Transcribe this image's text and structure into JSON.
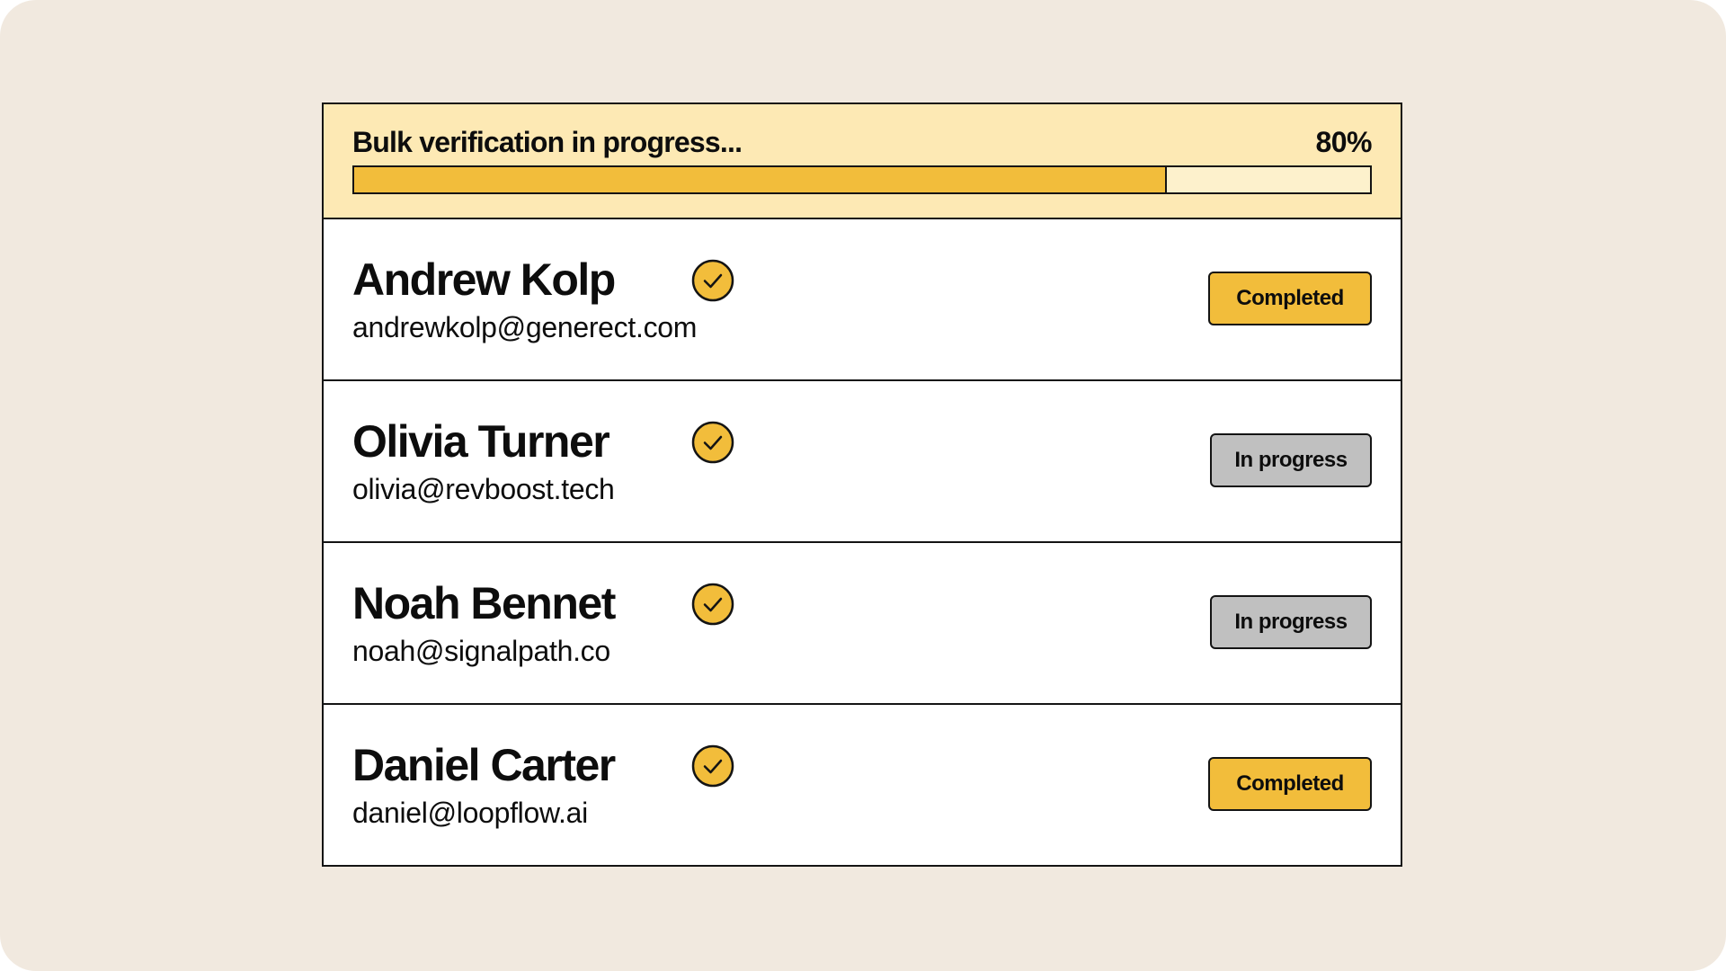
{
  "verification": {
    "title": "Bulk verification in progress...",
    "percent_label": "80%",
    "progress": 0.8,
    "accent_color": "#f2bd3b",
    "panel_color": "#fde9b4"
  },
  "contacts": [
    {
      "name": "Andrew Kolp",
      "email": "andrewkolp@generect.com",
      "status": "Completed",
      "verified_icon": "check-circle-icon"
    },
    {
      "name": "Olivia Turner",
      "email": "olivia@revboost.tech",
      "status": "In progress",
      "verified_icon": "check-circle-icon"
    },
    {
      "name": "Noah Bennet",
      "email": "noah@signalpath.co",
      "status": "In progress",
      "verified_icon": "check-circle-icon"
    },
    {
      "name": "Daniel Carter",
      "email": "daniel@loopflow.ai",
      "status": "Completed",
      "verified_icon": "check-circle-icon"
    }
  ],
  "status_colors": {
    "Completed": "#f2bd3b",
    "In progress": "#c0c0c0"
  }
}
